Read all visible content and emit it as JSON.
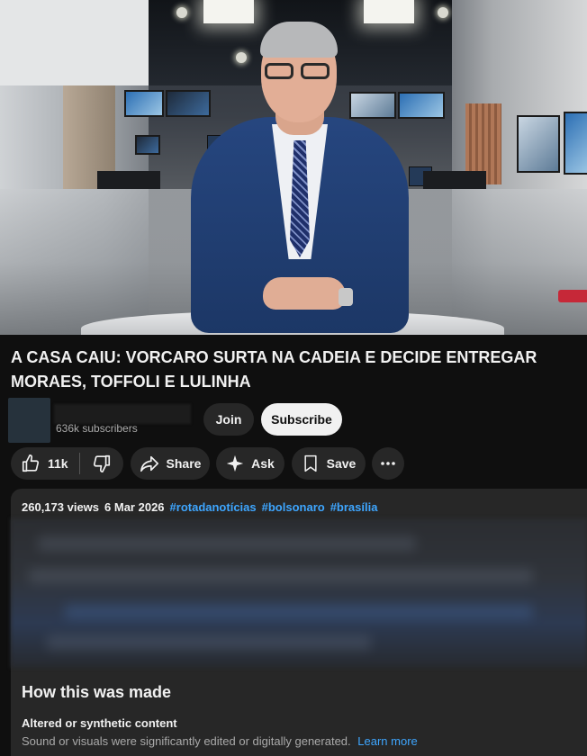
{
  "video": {
    "thumbnail_description": "studio-news-anchor"
  },
  "title": "A CASA CAIU: VORCARO SURTA NA CADEIA E DECIDE ENTREGAR MORAES, TOFFOLI E LULINHA",
  "channel": {
    "subscribers": "636k subscribers",
    "join_label": "Join",
    "subscribe_label": "Subscribe"
  },
  "actions": {
    "like_count": "11k",
    "share_label": "Share",
    "ask_label": "Ask",
    "save_label": "Save"
  },
  "description": {
    "views": "260,173 views",
    "date": "6 Mar 2026",
    "hashtags": [
      "#rotadanotícias",
      "#bolsonaro",
      "#brasília"
    ]
  },
  "how_made": {
    "heading": "How this was made",
    "label": "Altered or synthetic content",
    "text": "Sound or visuals were significantly edited or digitally generated.",
    "link": "Learn more"
  },
  "colors": {
    "background": "#0f0f0f",
    "surface": "#272727",
    "link": "#3ea6ff",
    "subscribe_bg": "#f1f1f1"
  }
}
